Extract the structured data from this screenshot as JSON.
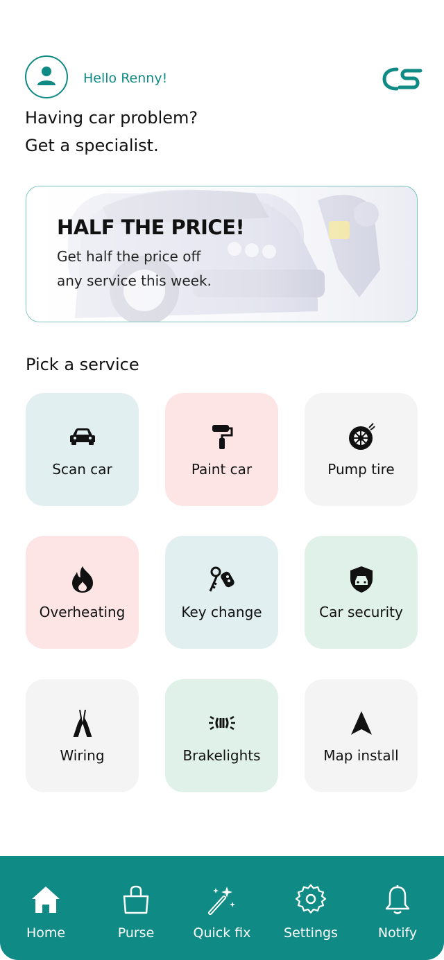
{
  "header": {
    "greeting": "Hello Renny!",
    "avatar_icon": "user-icon",
    "logo_icon": "brand-logo-icon"
  },
  "headline": {
    "line1": "Having car problem?",
    "line2": "Get a specialist."
  },
  "promo": {
    "title": "HALF THE PRICE!",
    "line1": "Get half the price off",
    "line2": "any service this week."
  },
  "services": {
    "title": "Pick a service",
    "items": [
      {
        "label": "Scan car",
        "icon": "car-icon",
        "color": "#e1eff0"
      },
      {
        "label": "Paint car",
        "icon": "paint-roller-icon",
        "color": "#fde4e5"
      },
      {
        "label": "Pump tire",
        "icon": "tire-icon",
        "color": "#f4f4f4"
      },
      {
        "label": "Overheating",
        "icon": "fire-icon",
        "color": "#fde4e5"
      },
      {
        "label": "Key change",
        "icon": "car-key-icon",
        "color": "#e1eff0"
      },
      {
        "label": "Car security",
        "icon": "shield-car-icon",
        "color": "#e0f1ea"
      },
      {
        "label": "Wiring",
        "icon": "pliers-icon",
        "color": "#f4f4f4"
      },
      {
        "label": "Brakelights",
        "icon": "brakelight-icon",
        "color": "#e0f1ea"
      },
      {
        "label": "Map install",
        "icon": "navigation-arrow-icon",
        "color": "#f4f4f4"
      }
    ]
  },
  "nav": {
    "items": [
      {
        "label": "Home",
        "icon": "home-icon"
      },
      {
        "label": "Purse",
        "icon": "bag-icon"
      },
      {
        "label": "Quick fix",
        "icon": "magic-wand-icon"
      },
      {
        "label": "Settings",
        "icon": "gear-icon"
      },
      {
        "label": "Notify",
        "icon": "bell-icon"
      }
    ],
    "active": "Home",
    "background": "#0f8a84"
  },
  "colors": {
    "accent": "#0f8a84"
  }
}
